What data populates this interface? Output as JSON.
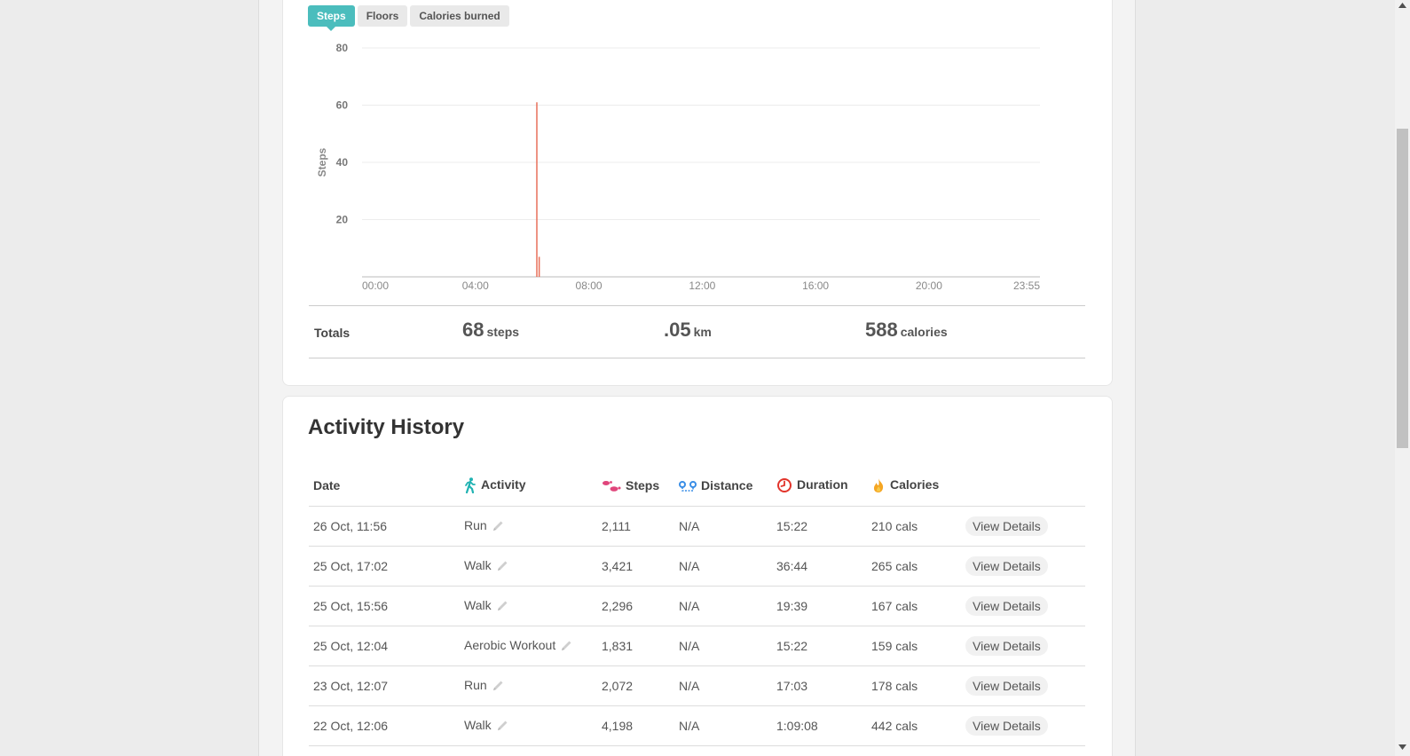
{
  "tabs": [
    {
      "label": "Steps",
      "active": true
    },
    {
      "label": "Floors",
      "active": false
    },
    {
      "label": "Calories burned",
      "active": false
    }
  ],
  "chart_data": {
    "type": "bar",
    "ylabel": "Steps",
    "ylim": [
      0,
      80
    ],
    "yticks": [
      "80",
      "60",
      "40",
      "20"
    ],
    "xtick_labels": [
      "00:00",
      "04:00",
      "08:00",
      "12:00",
      "16:00",
      "20:00",
      "23:55"
    ],
    "x": [
      "06:10",
      "06:15"
    ],
    "values": [
      61,
      7
    ],
    "color": "#e8705a",
    "grid": true
  },
  "totals": {
    "label": "Totals",
    "steps": {
      "value": "68",
      "unit": "steps"
    },
    "distance": {
      "value": ".05",
      "unit": "km"
    },
    "calories": {
      "value": "588",
      "unit": "calories"
    }
  },
  "history": {
    "title": "Activity History",
    "headers": {
      "date": "Date",
      "activity": "Activity",
      "steps": "Steps",
      "distance": "Distance",
      "duration": "Duration",
      "calories": "Calories"
    },
    "icons": {
      "activity": "walking-person-icon",
      "steps": "footprints-icon",
      "distance": "distance-icon",
      "duration": "clock-icon",
      "calories": "flame-icon",
      "edit": "pencil-icon"
    },
    "view_label": "View Details",
    "rows": [
      {
        "date": "26 Oct, 11:56",
        "activity": "Run",
        "steps": "2,111",
        "distance": "N/A",
        "duration": "15:22",
        "calories": "210 cals"
      },
      {
        "date": "25 Oct, 17:02",
        "activity": "Walk",
        "steps": "3,421",
        "distance": "N/A",
        "duration": "36:44",
        "calories": "265 cals"
      },
      {
        "date": "25 Oct, 15:56",
        "activity": "Walk",
        "steps": "2,296",
        "distance": "N/A",
        "duration": "19:39",
        "calories": "167 cals"
      },
      {
        "date": "25 Oct, 12:04",
        "activity": "Aerobic Workout",
        "steps": "1,831",
        "distance": "N/A",
        "duration": "15:22",
        "calories": "159 cals"
      },
      {
        "date": "23 Oct, 12:07",
        "activity": "Run",
        "steps": "2,072",
        "distance": "N/A",
        "duration": "17:03",
        "calories": "178 cals"
      },
      {
        "date": "22 Oct, 12:06",
        "activity": "Walk",
        "steps": "4,198",
        "distance": "N/A",
        "duration": "1:09:08",
        "calories": "442 cals"
      }
    ]
  },
  "colors": {
    "accent": "#4bbdbd",
    "bar": "#e8705a",
    "activity_icon": "#1fb2b2",
    "steps_icon": "#e0457b",
    "distance_icon": "#3a8ee6",
    "duration_icon": "#e2342b",
    "calories_icon": "#f5a623"
  }
}
